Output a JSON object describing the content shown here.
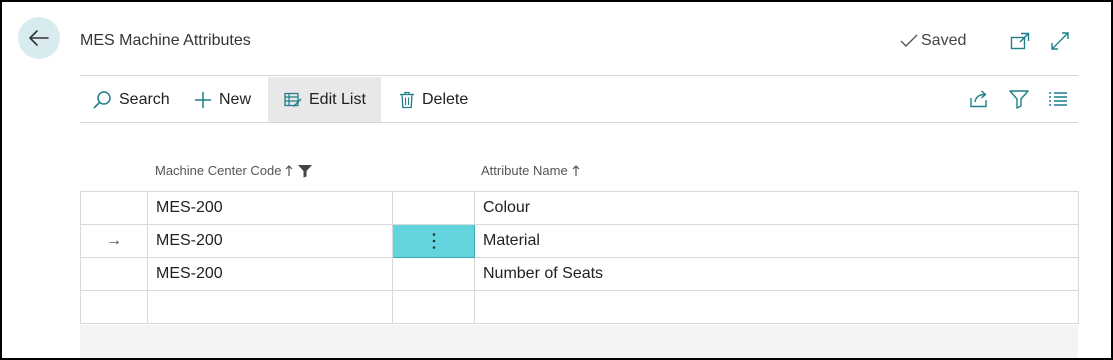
{
  "header": {
    "title": "MES Machine Attributes",
    "saved_label": "Saved"
  },
  "toolbar": {
    "search_label": "Search",
    "new_label": "New",
    "edit_list_label": "Edit List",
    "delete_label": "Delete"
  },
  "columns": {
    "machine_center_code": "Machine Center Code",
    "attribute_name": "Attribute Name"
  },
  "rows": [
    {
      "indicator": "",
      "code": "MES-200",
      "attribute": "Colour"
    },
    {
      "indicator": "→",
      "code": "MES-200",
      "attribute": "Material"
    },
    {
      "indicator": "",
      "code": "MES-200",
      "attribute": "Number of Seats"
    },
    {
      "indicator": "",
      "code": "",
      "attribute": ""
    }
  ],
  "colors": {
    "accent": "#1f7f8a",
    "selected_cell": "#62d4de",
    "back_button_bg": "#d8ecf0"
  }
}
